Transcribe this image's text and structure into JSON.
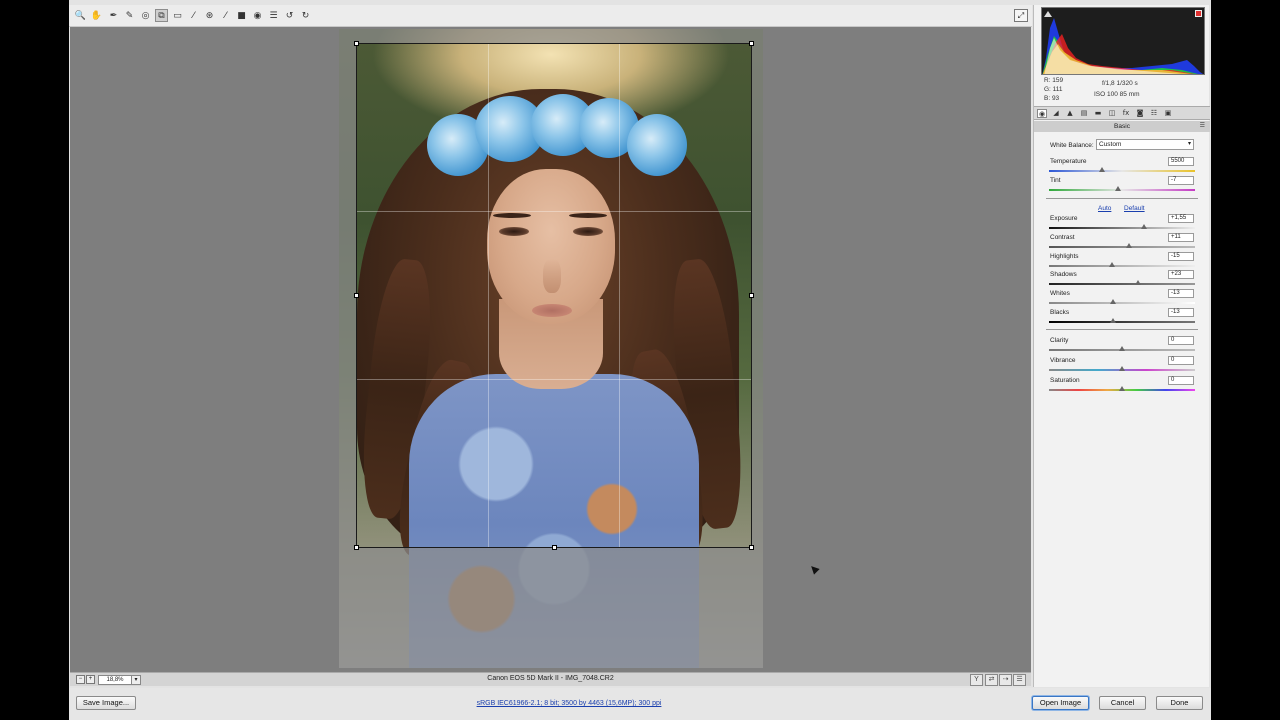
{
  "toolbar": {
    "tools": [
      {
        "name": "zoom-tool",
        "glyph": "🔍"
      },
      {
        "name": "hand-tool",
        "glyph": "✋"
      },
      {
        "name": "white-balance-tool",
        "glyph": "✒"
      },
      {
        "name": "color-sampler-tool",
        "glyph": "✎"
      },
      {
        "name": "targeted-adjustment-tool",
        "glyph": "◎"
      },
      {
        "name": "crop-tool",
        "glyph": "⧉"
      },
      {
        "name": "straighten-tool",
        "glyph": "▭"
      },
      {
        "name": "spot-removal-tool",
        "glyph": "⁄"
      },
      {
        "name": "red-eye-tool",
        "glyph": "⊛"
      },
      {
        "name": "adjustment-brush-tool",
        "glyph": "⁄"
      },
      {
        "name": "graduated-filter-tool",
        "glyph": "■"
      },
      {
        "name": "radial-filter-tool",
        "glyph": "◉"
      },
      {
        "name": "preferences-tool",
        "glyph": "☰"
      },
      {
        "name": "rotate-left-tool",
        "glyph": "↺"
      },
      {
        "name": "rotate-right-tool",
        "glyph": "↻"
      }
    ],
    "active_tool": "crop-tool"
  },
  "statusbar": {
    "zoom": "18,8%",
    "zoom_dropdown": "▾",
    "filename": "Canon EOS 5D Mark II  -  IMG_7048.CR2"
  },
  "bottombar": {
    "save_label": "Save Image...",
    "workflow_link": "sRGB IEC61966-2.1; 8 bit; 3500 by 4463 (15,6MP); 300 ppi",
    "open_label": "Open Image",
    "cancel_label": "Cancel",
    "done_label": "Done"
  },
  "readout": {
    "r": "R:   159",
    "g": "G:   111",
    "b": "B:    93",
    "aperture_shutter": "f/1,8    1/320 s",
    "iso_focal": "ISO 100    85 mm"
  },
  "panel": {
    "section_title": "Basic",
    "white_balance_label": "White Balance:",
    "white_balance_value": "Custom",
    "auto_label": "Auto",
    "default_label": "Default",
    "adjustments": [
      {
        "key": "temperature",
        "label": "Temperature",
        "value": "5500",
        "position": 0.36
      },
      {
        "key": "tint",
        "label": "Tint",
        "value": "-7",
        "position": 0.47
      },
      {
        "key": "exposure",
        "label": "Exposure",
        "value": "+1,55",
        "position": 0.65
      },
      {
        "key": "contrast",
        "label": "Contrast",
        "value": "+11",
        "position": 0.55
      },
      {
        "key": "highlights",
        "label": "Highlights",
        "value": "-15",
        "position": 0.43
      },
      {
        "key": "shadows",
        "label": "Shadows",
        "value": "+23",
        "position": 0.61
      },
      {
        "key": "whites",
        "label": "Whites",
        "value": "-13",
        "position": 0.44
      },
      {
        "key": "blacks",
        "label": "Blacks",
        "value": "-13",
        "position": 0.44
      },
      {
        "key": "clarity",
        "label": "Clarity",
        "value": "0",
        "position": 0.5
      },
      {
        "key": "vibrance",
        "label": "Vibrance",
        "value": "0",
        "position": 0.5
      },
      {
        "key": "saturation",
        "label": "Saturation",
        "value": "0",
        "position": 0.5
      }
    ]
  },
  "colors": {
    "accent_link": "#1a3fae",
    "default_button_border": "#3a76c4"
  }
}
